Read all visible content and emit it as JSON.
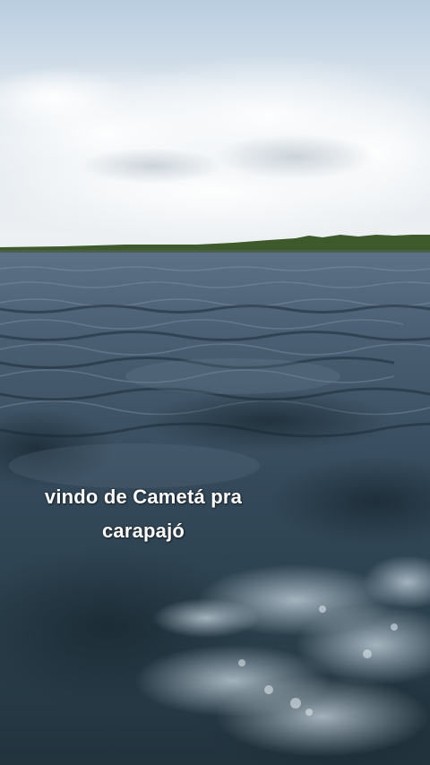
{
  "caption": {
    "line1": "vindo de Cametá pra",
    "line2": "carapajó"
  },
  "scene": {
    "sky_color": "#dce6ef",
    "water_color": "#2f4756",
    "treeline_color": "#3e5a2c"
  }
}
